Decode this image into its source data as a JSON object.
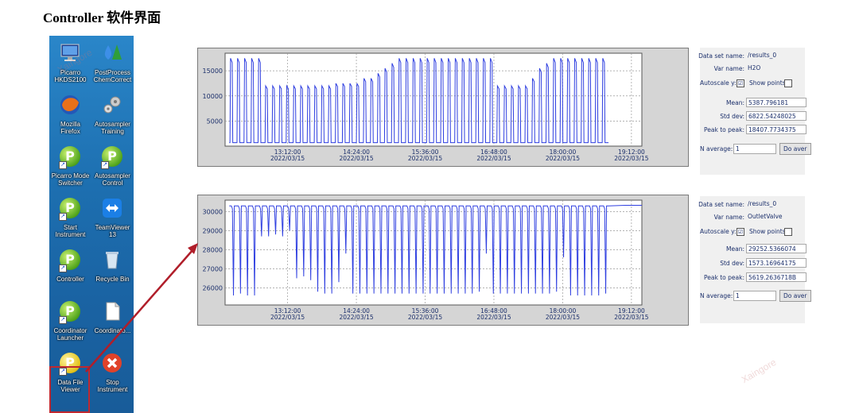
{
  "page": {
    "title": "Controller 软件界面",
    "watermark": "Xaingore"
  },
  "desktop": {
    "icons": [
      {
        "label": "Picarro\nHKDS2100",
        "icon": "monitor-icon"
      },
      {
        "label": "PostProcess\nChemCorrect",
        "icon": "water-drop-icon"
      },
      {
        "label": "Mozilla\nFirefox",
        "icon": "firefox-icon"
      },
      {
        "label": "Autosampler\nTraining",
        "icon": "gears-icon"
      },
      {
        "label": "Picarro Mode\nSwitcher",
        "icon": "picarro-p-icon"
      },
      {
        "label": "Autosampler\nControl",
        "icon": "picarro-p-icon"
      },
      {
        "label": "Start\nInstrument",
        "icon": "picarro-p-icon"
      },
      {
        "label": "TeamViewer\n13",
        "icon": "teamviewer-icon"
      },
      {
        "label": "Controller",
        "icon": "picarro-p-icon"
      },
      {
        "label": "Recycle Bin",
        "icon": "recycle-bin-icon"
      },
      {
        "label": "Coordinator\nLauncher",
        "icon": "picarro-p-icon"
      },
      {
        "label": "Coordinato...",
        "icon": "document-icon"
      },
      {
        "label": "Data File\nViewer",
        "icon": "picarro-p-icon"
      },
      {
        "label": "Stop\nInstrument",
        "icon": "stop-x-icon"
      }
    ]
  },
  "panels": [
    {
      "dataset_label": "Data set name:",
      "dataset_value": "/results_0",
      "var_label": "Var name:",
      "var_value": "H2O",
      "autoscale_label": "Autoscale y:",
      "autoscale_checked": "☑",
      "showpoints_label": "Show points:",
      "mean_label": "Mean:",
      "mean_value": "5387.796181",
      "std_label": "Std dev:",
      "std_value": "6822.54248025",
      "p2p_label": "Peak to peak:",
      "p2p_value": "18407.7734375",
      "navg_label": "N average:",
      "navg_value": "1",
      "navg_button": "Do aver"
    },
    {
      "dataset_label": "Data set name:",
      "dataset_value": "/results_0",
      "var_label": "Var name:",
      "var_value": "OutletValve",
      "autoscale_label": "Autoscale y:",
      "autoscale_checked": "☑",
      "showpoints_label": "Show points:",
      "mean_label": "Mean:",
      "mean_value": "29252.5366074",
      "std_label": "Std dev:",
      "std_value": "1573.16964175",
      "p2p_label": "Peak to peak:",
      "p2p_value": "5619.2636718B",
      "navg_label": "N average:",
      "navg_value": "1",
      "navg_button": "Do aver"
    }
  ],
  "chart_data": [
    {
      "type": "line",
      "series": [
        {
          "name": "H2O",
          "color": "#2f3fe0"
        }
      ],
      "x_tick_labels": [
        [
          "13:12:00",
          "2022/03/15"
        ],
        [
          "14:24:00",
          "2022/03/15"
        ],
        [
          "15:36:00",
          "2022/03/15"
        ],
        [
          "16:48:00",
          "2022/03/15"
        ],
        [
          "18:00:00",
          "2022/03/15"
        ],
        [
          "19:12:00",
          "2022/03/15"
        ]
      ],
      "y_ticks": [
        5000,
        10000,
        15000
      ],
      "ylim": [
        0,
        18500
      ],
      "grid": true,
      "pulses": [
        17500,
        17500,
        17500,
        17500,
        17500,
        12000,
        12000,
        12000,
        12000,
        12000,
        12000,
        12000,
        12000,
        12000,
        12000,
        12500,
        12500,
        12500,
        12500,
        13500,
        13500,
        14500,
        15500,
        16500,
        17500,
        17500,
        17500,
        17500,
        17500,
        17500,
        17500,
        17500,
        17500,
        17500,
        17500,
        17500,
        17500,
        17500,
        12000,
        12000,
        12000,
        12000,
        12000,
        13500,
        15500,
        16500,
        17500,
        17500,
        17500,
        17500,
        17500,
        17500,
        17500,
        17500
      ],
      "baseline": 700
    },
    {
      "type": "line",
      "series": [
        {
          "name": "OutletValve",
          "color": "#2f3fe0"
        }
      ],
      "x_tick_labels": [
        [
          "13:12:00",
          "2022/03/15"
        ],
        [
          "14:24:00",
          "2022/03/15"
        ],
        [
          "15:36:00",
          "2022/03/15"
        ],
        [
          "16:48:00",
          "2022/03/15"
        ],
        [
          "18:00:00",
          "2022/03/15"
        ],
        [
          "19:12:00",
          "2022/03/15"
        ]
      ],
      "y_ticks": [
        26000,
        27000,
        28000,
        29000,
        30000
      ],
      "ylim": [
        25100,
        30600
      ],
      "grid": true,
      "dips": [
        25600,
        25700,
        25600,
        25600,
        28700,
        28700,
        28800,
        28700,
        29000,
        26500,
        26600,
        26400,
        25800,
        25700,
        25700,
        26300,
        27800,
        25700,
        25700,
        25700,
        25700,
        25700,
        25700,
        25700,
        25700,
        25700,
        25700,
        25700,
        25700,
        25700,
        25700,
        25700,
        25700,
        25700,
        25700,
        25800,
        27800,
        25700,
        25700,
        25700,
        25700,
        25700,
        25700,
        25700,
        25700,
        25700,
        25800,
        27600,
        25600,
        25600,
        25600,
        25600,
        25600,
        25700
      ],
      "top": 30300
    }
  ]
}
